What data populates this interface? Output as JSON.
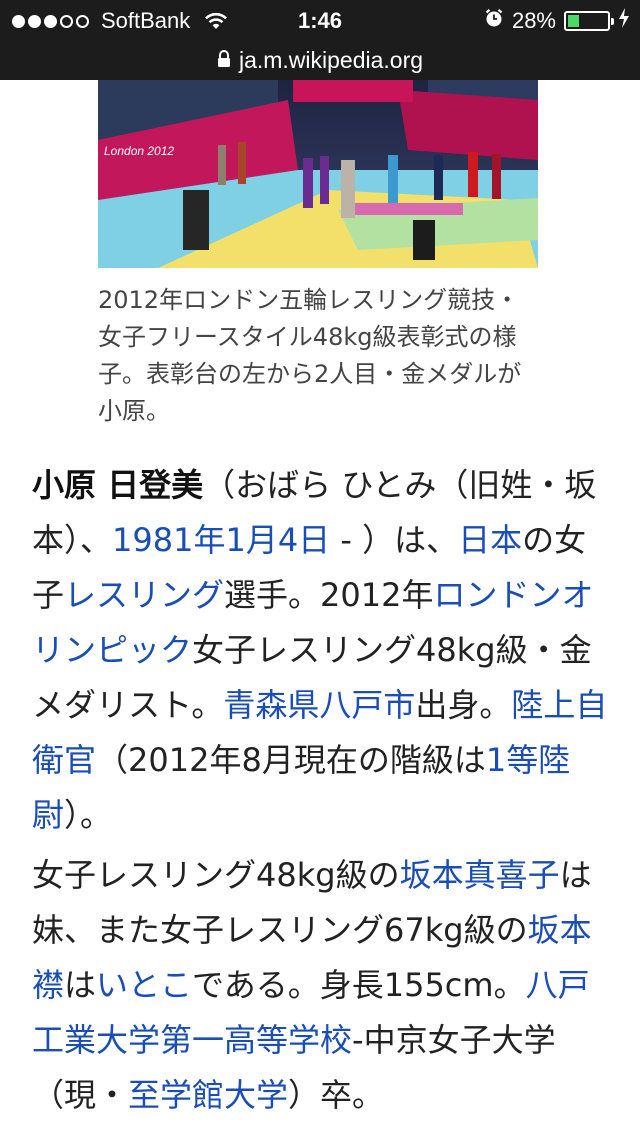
{
  "status_bar": {
    "carrier": "SoftBank",
    "time": "1:46",
    "battery_percent": "28%",
    "signal_bars_filled": 3,
    "signal_bars_total": 5,
    "battery_level": 0.28
  },
  "url_bar": {
    "host": "ja.m.wikipedia.org"
  },
  "figure": {
    "photo_sign": "London 2012",
    "caption": "2012年ロンドン五輪レスリング競技・女子フリースタイル48kg級表彰式の様子。表彰台の左から2人目・金メダルが小原。"
  },
  "intro": {
    "name": "小原 日登美",
    "t1": "（おばら ひとみ（旧姓・坂本）、",
    "link_birthdate": "1981年1月4日",
    "t2": " - ）は、",
    "link_japan": "日本",
    "t3": "の女子",
    "link_wrestling": "レスリング",
    "t4": "選手。2012年",
    "link_london_olympics": "ロンドンオリンピック",
    "t5": "女子レスリング48kg級・金メダリスト。",
    "link_hachinohe": "青森県八戸市",
    "t6": "出身。",
    "link_jsdf": "陸上自衛官",
    "t7": "（2012年8月現在の階級は",
    "link_rank": "1等陸尉",
    "t8": "）。"
  },
  "family": {
    "t1": "女子レスリング48kg級の",
    "link_makiko": "坂本真喜子",
    "t2": "は妹、また女子レスリング67kg級の",
    "link_eri": "坂本襟",
    "t3": "は",
    "link_cousin": "いとこ",
    "t4": "である。身長155cm。",
    "link_school": "八戸工業大学第一高等学校",
    "t5": "-中京女子大学（現・",
    "link_univ": "至学館大学",
    "t6": "）卒。"
  },
  "colors": {
    "link": "#1a4eb6",
    "text": "#222222",
    "caption": "#444444",
    "status_bar_bg": "#1c1c1c",
    "battery_green": "#4cd964"
  }
}
